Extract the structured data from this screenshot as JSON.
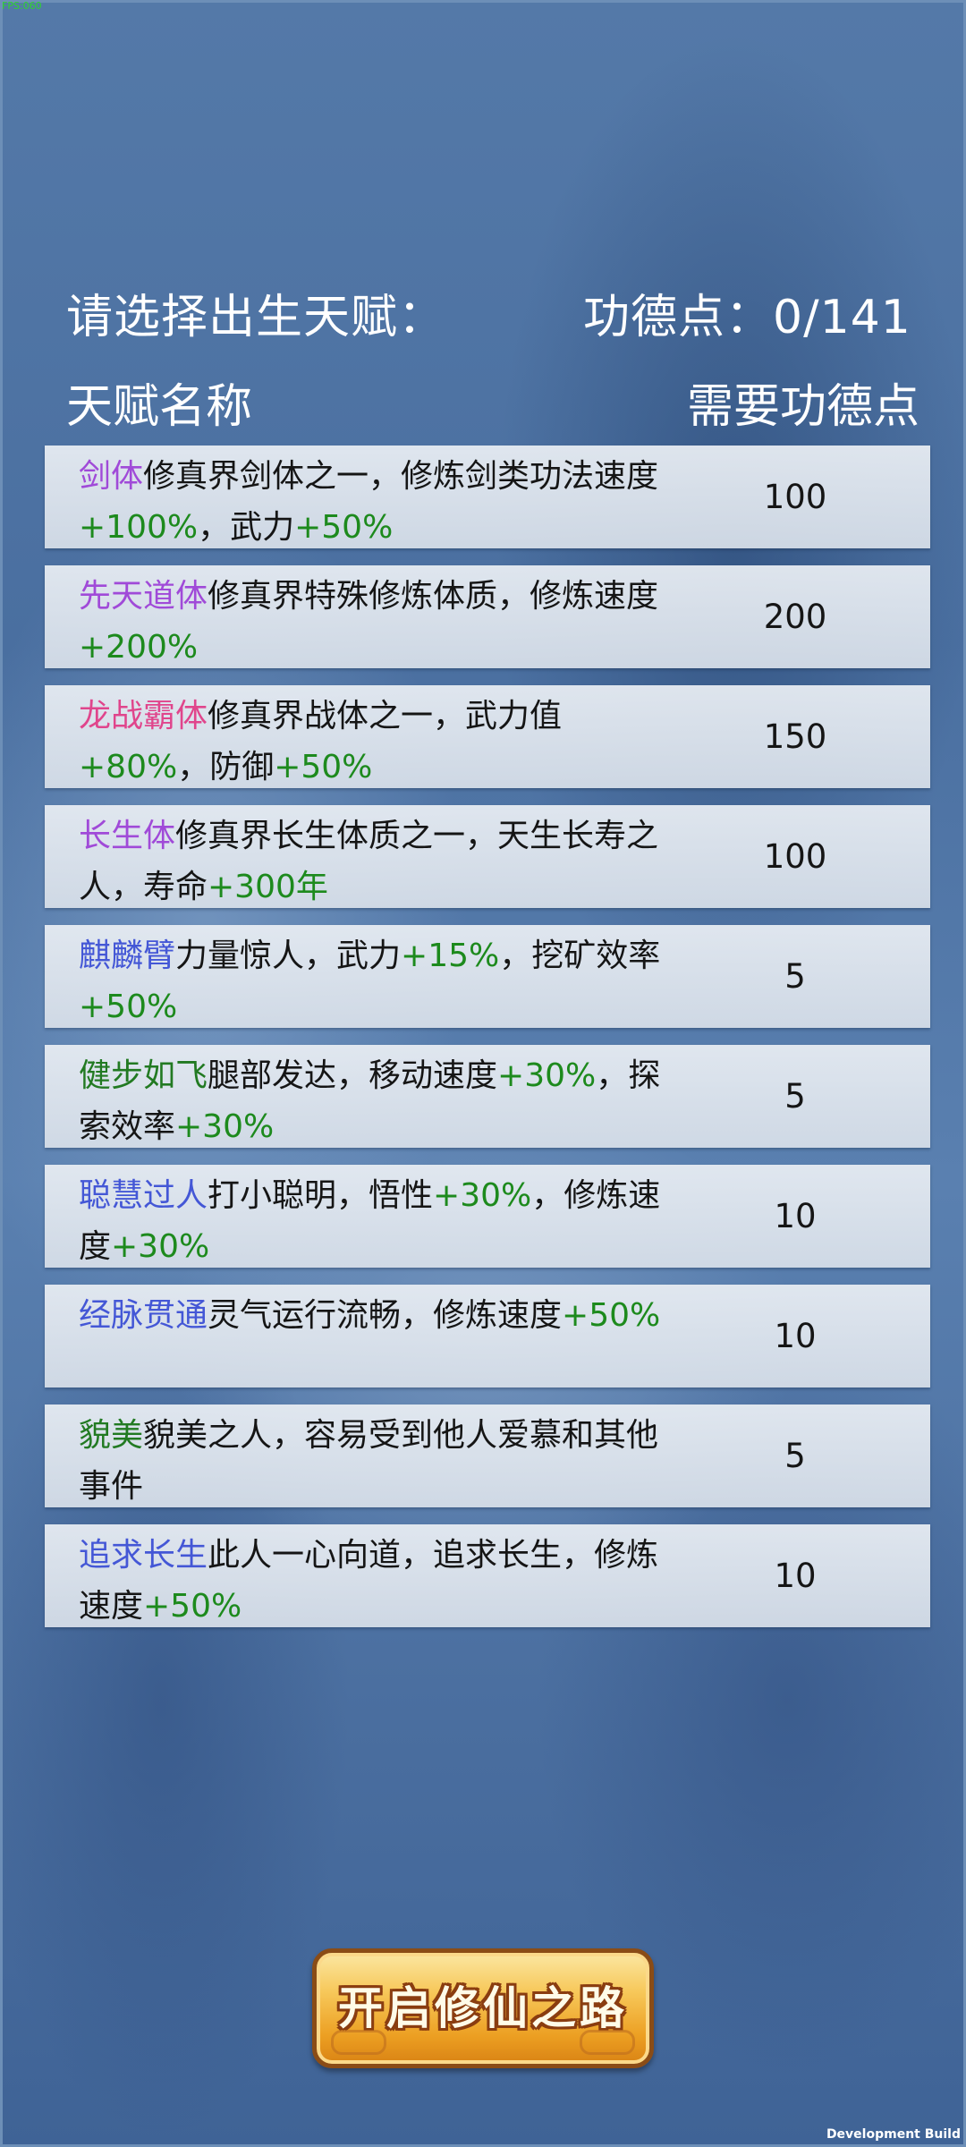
{
  "debug": {
    "fps": "FPS:060"
  },
  "header": {
    "prompt": "请选择出生天赋：",
    "merit": "功德点：0/141"
  },
  "columns": {
    "name": "天赋名称",
    "cost": "需要功德点"
  },
  "talents": [
    {
      "name": "剑体",
      "name_color": "purple",
      "desc": [
        "修真界剑体之一，修炼剑类功法速度",
        {
          "g": "+100%"
        },
        "，武力",
        {
          "g": "+50%"
        }
      ],
      "cost": "100"
    },
    {
      "name": "先天道体",
      "name_color": "purple",
      "desc": [
        "修真界特殊修炼体质，修炼速度",
        {
          "g": "+200%"
        }
      ],
      "cost": "200"
    },
    {
      "name": "龙战霸体",
      "name_color": "pink",
      "desc": [
        "修真界战体之一，武力值",
        {
          "g": "+80%"
        },
        "，防御",
        {
          "g": "+50%"
        }
      ],
      "cost": "150"
    },
    {
      "name": "长生体",
      "name_color": "purple",
      "desc": [
        "修真界长生体质之一，天生长寿之人，寿命",
        {
          "g": "+300年"
        }
      ],
      "cost": "100"
    },
    {
      "name": "麒麟臂",
      "name_color": "blue",
      "desc": [
        "力量惊人，武力",
        {
          "g": "+15%"
        },
        "，挖矿效率",
        {
          "g": "+50%"
        }
      ],
      "cost": "5"
    },
    {
      "name": "健步如飞",
      "name_color": "green",
      "desc": [
        "腿部发达，移动速度",
        {
          "g": "+30%"
        },
        "，探索效率",
        {
          "g": "+30%"
        }
      ],
      "cost": "5"
    },
    {
      "name": "聪慧过人",
      "name_color": "blue",
      "desc": [
        "打小聪明，悟性",
        {
          "g": "+30%"
        },
        "，修炼速度",
        {
          "g": "+30%"
        }
      ],
      "cost": "10"
    },
    {
      "name": "经脉贯通",
      "name_color": "blue",
      "desc": [
        "灵气运行流畅，修炼速度",
        {
          "g": "+50%"
        }
      ],
      "cost": "10"
    },
    {
      "name": "貌美",
      "name_color": "green",
      "desc": [
        "貌美之人，容易受到他人爱慕和其他事件"
      ],
      "cost": "5"
    },
    {
      "name": "追求长生",
      "name_color": "blue",
      "desc": [
        "此人一心向道，追求长生，修炼速度",
        {
          "g": "+50%"
        }
      ],
      "cost": "10"
    }
  ],
  "start_button": {
    "label": "开启修仙之路"
  },
  "footer": {
    "build": "Development Build"
  },
  "colors": {
    "purple": "#a04ad8",
    "pink": "#e0458c",
    "blue": "#4457d6",
    "green": "#227a22",
    "bonus": "#1d8a1d"
  }
}
